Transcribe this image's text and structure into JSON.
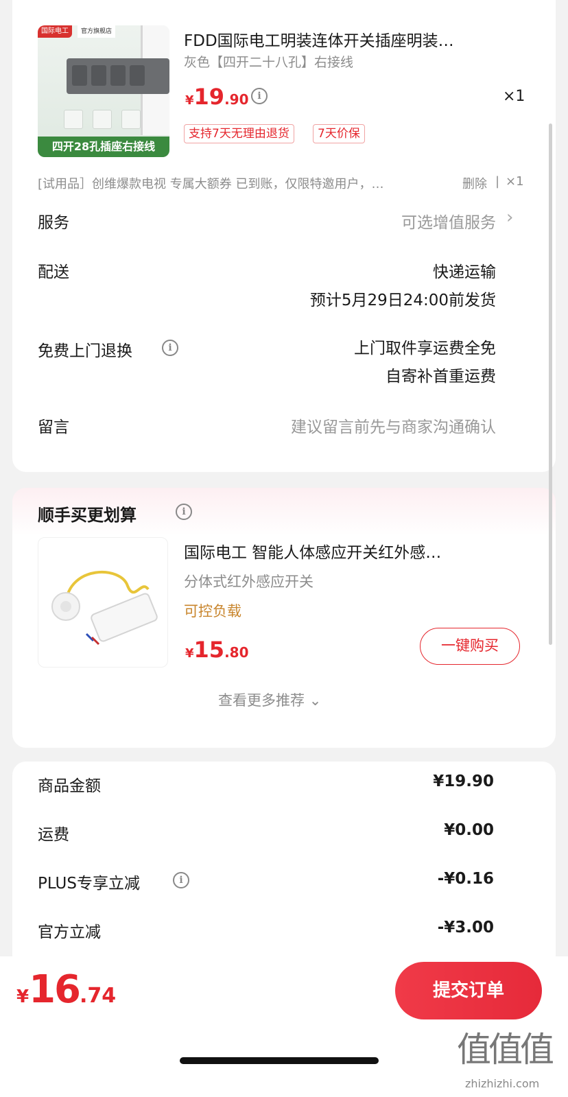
{
  "product": {
    "title": "FDD国际电工明装连体开关插座明装…",
    "spec": "灰色【四开二十八孔】右接线",
    "price_yen": "¥",
    "price_int": "19",
    "price_dec": ".90",
    "quantity": "×1",
    "image_banner": "四开28孔插座右接线",
    "image_brand": "国际电工",
    "image_store": "官方旗舰店",
    "tags": [
      "支持7天无理由退货",
      "7天价保"
    ]
  },
  "trial": {
    "text": "[试用品］创维爆款电视 专属大额券 已到账，仅限特邀用户，…",
    "delete": "删除",
    "sep": "|",
    "quantity": "×1"
  },
  "rows": {
    "service_label": "服务",
    "service_value": "可选增值服务",
    "service_chevron": "›",
    "delivery_label": "配送",
    "delivery_line1": "快递运输",
    "delivery_line2": "预计5月29日24:00前发货",
    "return_label": "免费上门退换",
    "return_line1": "上门取件享运费全免",
    "return_line2": "自寄补首重运费",
    "message_label": "留言",
    "message_placeholder": "建议留言前先与商家沟通确认"
  },
  "upsell": {
    "section_title": "顺手买更划算",
    "title": "国际电工 智能人体感应开关红外感…",
    "spec": "分体式红外感应开关",
    "highlight": "可控负载",
    "price_yen": "¥",
    "price_int": "15",
    "price_dec": ".80",
    "buy_label": "一键购买",
    "more_label": "查看更多推荐",
    "more_chevron": "⌄"
  },
  "summary": {
    "items": [
      {
        "label": "商品金额",
        "value": "¥19.90",
        "discount": false
      },
      {
        "label": "运费",
        "value": "¥0.00",
        "discount": false
      },
      {
        "label": "PLUS专享立减",
        "value": "-¥0.16",
        "discount": true
      },
      {
        "label": "官方立减",
        "value": "-¥3.00",
        "discount": true
      }
    ]
  },
  "bottom": {
    "total_yen": "¥",
    "total_int": "16",
    "total_dec": ".74",
    "submit_label": "提交订单"
  },
  "watermark": {
    "glyphs": "值值值",
    "site": "zhizhizhi.com"
  },
  "colors": {
    "accent": "#e5262d",
    "highlight": "#c8852c",
    "background": "#f2f2f2"
  }
}
